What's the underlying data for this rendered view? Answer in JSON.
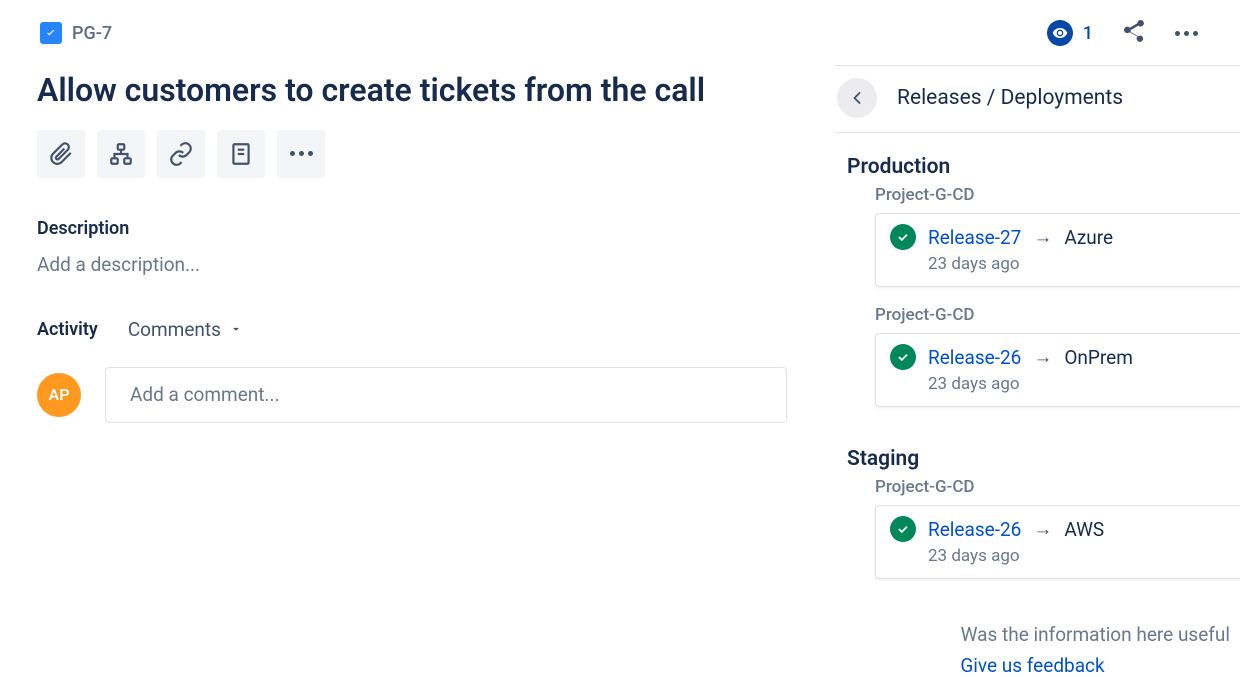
{
  "issue_key": "PG-7",
  "watch_count": "1",
  "title": "Allow customers to create tickets from the call",
  "description_label": "Description",
  "description_placeholder": "Add a description...",
  "activity_label": "Activity",
  "activity_dropdown": "Comments",
  "avatar_initials": "AP",
  "comment_placeholder": "Add a comment...",
  "panel_title": "Releases / Deployments",
  "feedback_question": "Was the information here useful",
  "feedback_link": "Give us feedback",
  "environments": [
    {
      "env": "Production",
      "groups": [
        {
          "project": "Project-G-CD",
          "release": "Release-27",
          "target": "Azure",
          "time": "23 days ago"
        },
        {
          "project": "Project-G-CD",
          "release": "Release-26",
          "target": "OnPrem",
          "time": "23 days ago"
        }
      ]
    },
    {
      "env": "Staging",
      "groups": [
        {
          "project": "Project-G-CD",
          "release": "Release-26",
          "target": "AWS",
          "time": "23 days ago"
        }
      ]
    }
  ]
}
